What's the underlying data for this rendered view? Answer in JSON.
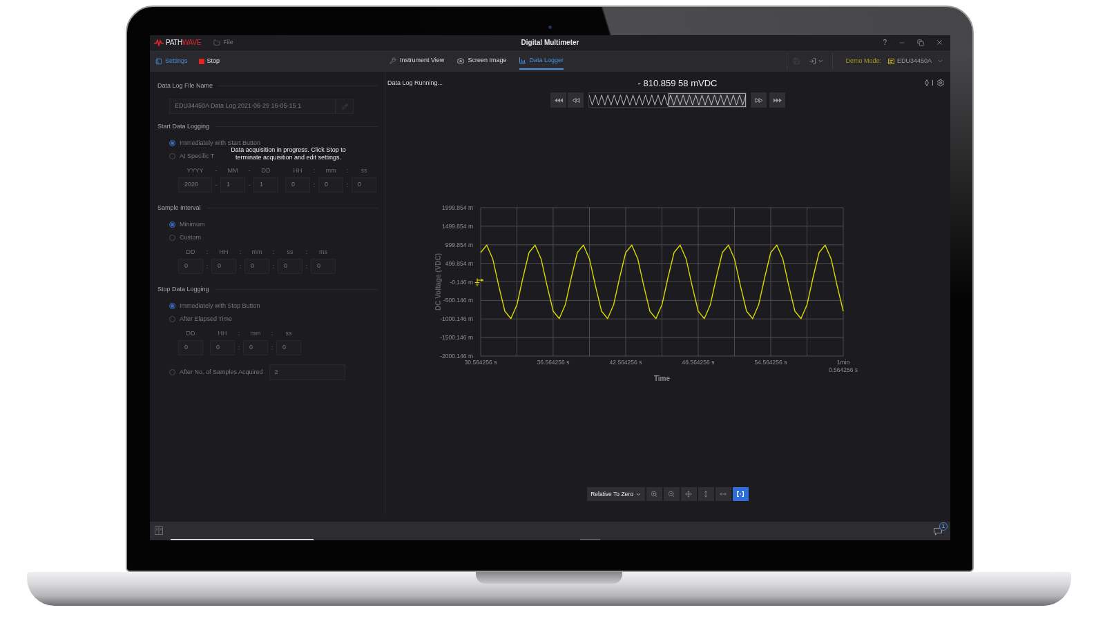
{
  "window": {
    "logo": [
      "PATH",
      "WAVE"
    ],
    "file_menu": {
      "label": "File",
      "disabled": true
    },
    "title": "Digital Multimeter",
    "help": "?"
  },
  "toolbar": {
    "actions": [
      {
        "label": "Settings",
        "active": true
      },
      {
        "label": "Stop",
        "active": false
      }
    ],
    "tabs": [
      {
        "label": "Instrument View",
        "selected": false
      },
      {
        "label": "Screen Image",
        "selected": false
      },
      {
        "label": "Data Logger",
        "selected": true
      }
    ],
    "demo_mode": {
      "label": "Demo Mode:",
      "instrument": "EDU34450A"
    }
  },
  "settings_panel": {
    "disabled": true,
    "file_name": {
      "title": "Data Log File Name",
      "value": "EDU34450A Data Log 2021-06-29 16-05-15 1"
    },
    "sections": [
      {
        "title": "Start Data Logging",
        "options": [
          {
            "label": "Immediately with Start Button",
            "selected": true
          },
          {
            "label": "At Specific T",
            "selected": false,
            "time_fields": [
              {
                "kind": "field",
                "label": "YYYY",
                "value": "2020"
              },
              {
                "kind": "separator",
                "label": "-",
                "value": "-"
              },
              {
                "kind": "field",
                "label": "MM",
                "value": "1"
              },
              {
                "kind": "separator",
                "label": "-",
                "value": "-"
              },
              {
                "kind": "field",
                "label": "DD",
                "value": "1"
              },
              {
                "kind": "field",
                "label": "HH",
                "value": "0"
              },
              {
                "kind": "separator",
                "label": ":",
                "value": ":"
              },
              {
                "kind": "field",
                "label": "mm",
                "value": "0"
              },
              {
                "kind": "separator",
                "label": ":",
                "value": ":"
              },
              {
                "kind": "field",
                "label": "ss",
                "value": "0"
              }
            ]
          }
        ]
      },
      {
        "title": "Sample Interval",
        "options": [
          {
            "label": "Minimum",
            "selected": true
          },
          {
            "label": "Custom",
            "selected": false,
            "time_fields": [
              {
                "kind": "field",
                "label": "DD",
                "value": "0"
              },
              {
                "kind": "separator",
                "label": ":",
                "value": ":"
              },
              {
                "kind": "field",
                "label": "HH",
                "value": "0"
              },
              {
                "kind": "separator",
                "label": ":",
                "value": ":"
              },
              {
                "kind": "field",
                "label": "mm",
                "value": "0"
              },
              {
                "kind": "separator",
                "label": ":",
                "value": ":"
              },
              {
                "kind": "field",
                "label": "ss",
                "value": "0"
              },
              {
                "kind": "separator",
                "label": ":",
                "value": ":"
              },
              {
                "kind": "field",
                "label": "ms",
                "value": "0"
              }
            ]
          }
        ]
      },
      {
        "title": "Stop Data Logging",
        "options": [
          {
            "label": "Immediately with Stop Button",
            "selected": true
          },
          {
            "label": "After Elapsed Time",
            "selected": false,
            "time_fields": [
              {
                "kind": "field",
                "label": "DD",
                "value": "0"
              },
              {
                "kind": "field",
                "label": "HH",
                "value": "0"
              },
              {
                "kind": "separator",
                "label": ":",
                "value": ":"
              },
              {
                "kind": "field",
                "label": "mm",
                "value": "0"
              },
              {
                "kind": "separator",
                "label": ":",
                "value": ":"
              },
              {
                "kind": "field",
                "label": "ss",
                "value": "0"
              }
            ]
          },
          {
            "label": "After No. of Samples Acquired",
            "selected": false,
            "input": "2"
          }
        ]
      }
    ],
    "tooltip": "Data acquisition in progress. Click Stop to terminate acquisition and edit settings."
  },
  "data_logger": {
    "status": "Data Log Running...",
    "reading": "- 810.859 58 mVDC",
    "chart_data": {
      "type": "line",
      "xlabel": "Time",
      "ylabel": "DC Voltage (VDC)",
      "grid": true,
      "x": [
        30.564256,
        31.064256,
        31.564256,
        32.064256,
        32.564256,
        33.064256,
        33.564256,
        34.064256,
        34.564256,
        35.064256,
        35.564256,
        36.064256,
        36.564256,
        37.064256,
        37.564256,
        38.064256,
        38.564256,
        39.064256,
        39.564256,
        40.064256,
        40.564256,
        41.064256,
        41.564256,
        42.064256,
        42.564256,
        43.064256,
        43.564256,
        44.064256,
        44.564256,
        45.064256,
        45.564256,
        46.064256,
        46.564256,
        47.064256,
        47.564256,
        48.064256,
        48.564256,
        49.064256,
        49.564256,
        50.064256,
        50.564256,
        51.064256,
        51.564256,
        52.064256,
        52.564256,
        53.064256,
        53.564256,
        54.064256,
        54.564256,
        55.064256,
        55.564256,
        56.064256,
        56.564256,
        57.064256,
        57.564256,
        58.064256,
        58.564256,
        59.064256,
        59.564256,
        60.064256,
        60.564256
      ],
      "series": [
        {
          "color": "#d9d900",
          "values": [
            790,
            990,
            620,
            -120,
            -790,
            -990,
            -620,
            120,
            790,
            990,
            620,
            -120,
            -790,
            -990,
            -620,
            120,
            790,
            990,
            620,
            -120,
            -790,
            -990,
            -620,
            120,
            790,
            990,
            620,
            -120,
            -790,
            -990,
            -620,
            120,
            790,
            990,
            620,
            -120,
            -790,
            -990,
            -620,
            120,
            790,
            990,
            620,
            -120,
            -790,
            -990,
            -620,
            120,
            790,
            990,
            620,
            -120,
            -790,
            -990,
            -620,
            120,
            790,
            990,
            620,
            -120,
            -790
          ]
        }
      ],
      "xlim": [
        30.564256,
        60.564256
      ],
      "ylim": [
        -2000.146,
        1999.854
      ],
      "xticks": [
        {
          "value": 30.564256,
          "label": "30.564256 s"
        },
        {
          "value": 36.564256,
          "label": "36.564256 s"
        },
        {
          "value": 42.564256,
          "label": "42.564256 s"
        },
        {
          "value": 48.564256,
          "label": "48.564256 s"
        },
        {
          "value": 54.564256,
          "label": "54.564256 s"
        },
        {
          "value": 60.564256,
          "label": "1min\n0.564256 s"
        }
      ],
      "yticks": [
        {
          "value": 1999.854,
          "label": "1999.854 m"
        },
        {
          "value": 1499.854,
          "label": "1499.854 m"
        },
        {
          "value": 999.854,
          "label": "999.854 m"
        },
        {
          "value": 499.854,
          "label": "499.854 m"
        },
        {
          "value": -0.146,
          "label": "-0.146 m"
        },
        {
          "value": -500.146,
          "label": "-500.146 m"
        },
        {
          "value": -1000.146,
          "label": "-1000.146 m"
        },
        {
          "value": -1500.146,
          "label": "-1500.146 m"
        },
        {
          "value": -2000.146,
          "label": "-2000.146 m"
        }
      ]
    },
    "view_mode": "Relative To Zero",
    "chart_tools": [
      {
        "selected": false
      },
      {
        "selected": false
      },
      {
        "selected": false
      },
      {
        "selected": false
      },
      {
        "selected": false
      },
      {
        "selected": true
      }
    ]
  },
  "status_bar": {
    "notifications": "1"
  }
}
